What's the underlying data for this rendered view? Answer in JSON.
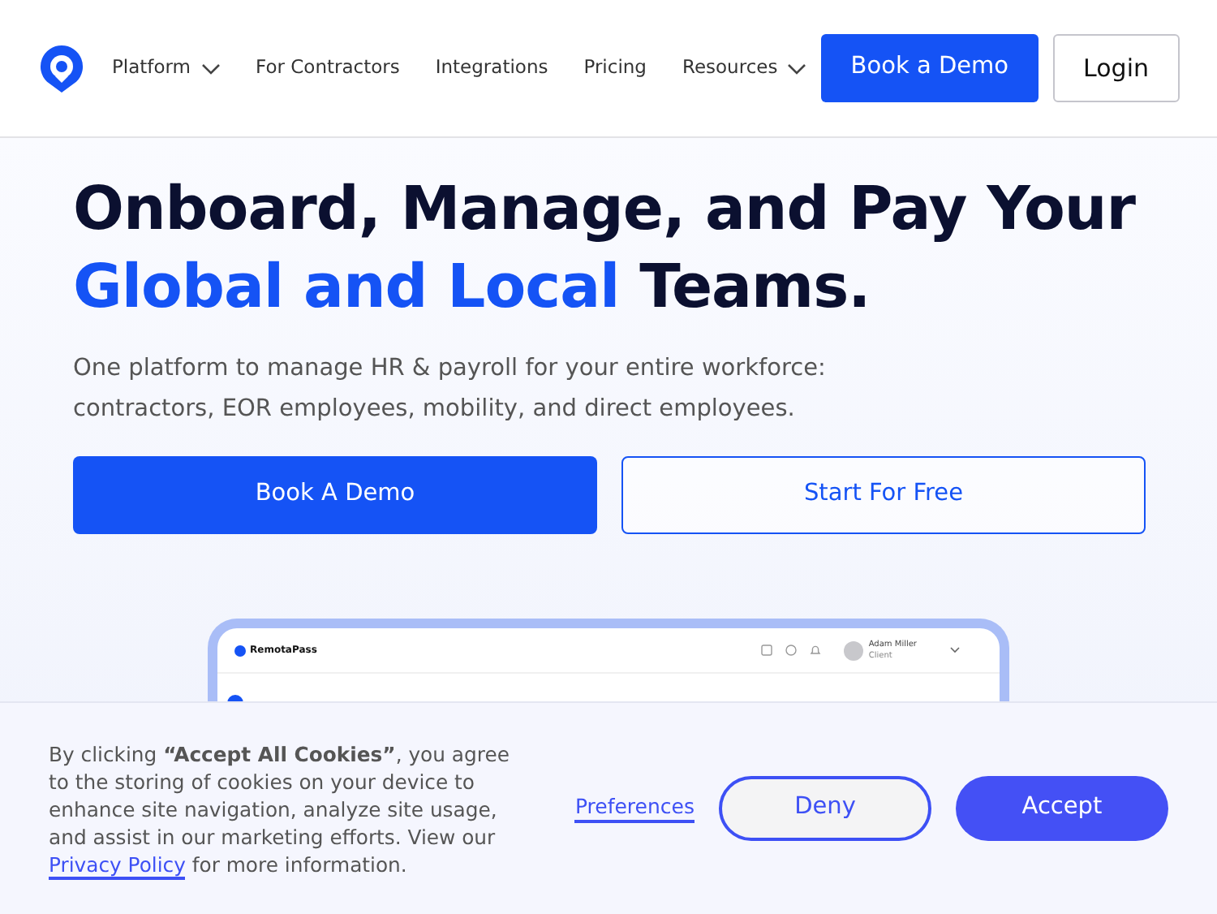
{
  "nav": {
    "items": [
      {
        "label": "Platform",
        "dropdown": true
      },
      {
        "label": "For Contractors",
        "dropdown": false
      },
      {
        "label": "Integrations",
        "dropdown": false
      },
      {
        "label": "Pricing",
        "dropdown": false
      },
      {
        "label": "Resources",
        "dropdown": true
      }
    ],
    "buttons": [
      {
        "label": "Book a Demo",
        "kind": "primary"
      },
      {
        "label": "Login",
        "kind": "outline"
      }
    ]
  },
  "hero": {
    "headline_line_1": "Onboard, Manage, and Pay Your",
    "headline_highlight": "Global and Local",
    "headline_rest": "Teams.",
    "subtitle": "One platform to manage HR & payroll for your entire workforce: contractors, EOR employees, mobility, and direct employees.",
    "buttons": [
      {
        "label": "Book A Demo",
        "kind": "primary"
      },
      {
        "label": "Start For Free",
        "kind": "outline"
      }
    ]
  },
  "app_preview": {
    "brand": "RemotaPass",
    "user_name": "Adam Miller",
    "user_role": "Client"
  },
  "cookie_banner": {
    "text": "By clicking **“Accept All Cookies”**, you agree to the storing of cookies on your device to enhance site navigation, analyze site usage, and assist in our marketing efforts. View our",
    "link": "Privacy Policy",
    "text_after": "for more information.",
    "preferences": "Preferences",
    "buttons": [
      {
        "label": "Deny",
        "kind": "outline"
      },
      {
        "label": "Accept",
        "kind": "primary"
      }
    ]
  }
}
